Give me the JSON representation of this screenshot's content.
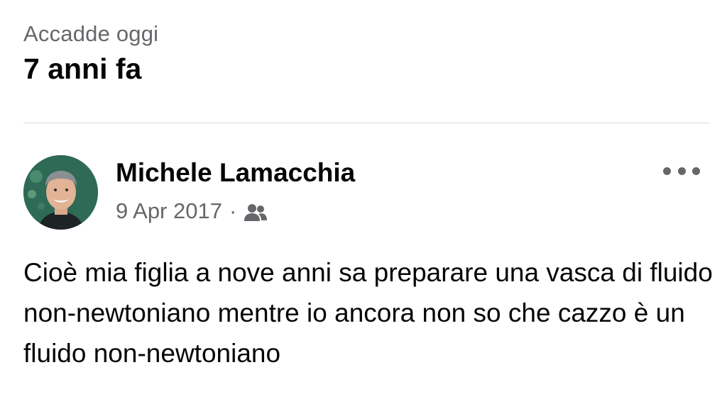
{
  "memory": {
    "label": "Accadde oggi",
    "title": "7 anni fa"
  },
  "post": {
    "author": "Michele Lamacchia",
    "date": "9 Apr 2017",
    "separator": "·",
    "audience_icon": "friends-icon",
    "more_icon": "more-options-icon",
    "text": "Cioè mia figlia a nove anni sa preparare una vasca di fluido non-newtoniano mentre io ancora non so che cazzo è un fluido non-newtoniano"
  },
  "colors": {
    "primary_text": "#050505",
    "secondary_text": "#65676b",
    "divider": "#dadde1",
    "background": "#ffffff"
  }
}
